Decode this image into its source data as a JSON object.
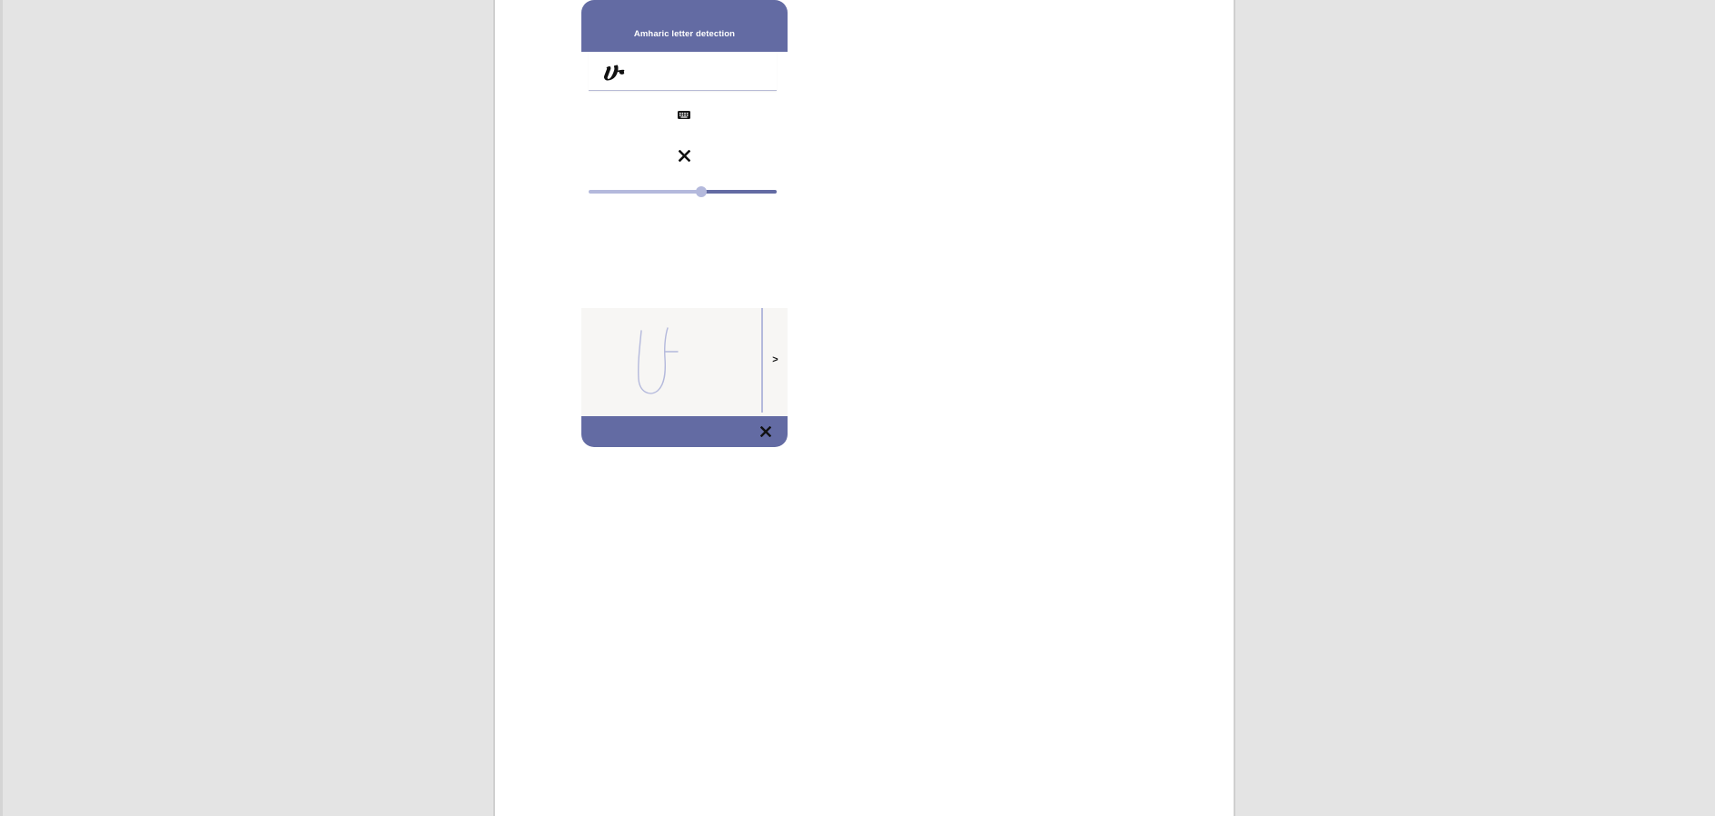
{
  "app": {
    "title": "Amharic letter detection",
    "accent_color": "#636ba3",
    "accent_light_color": "#b4b9dc"
  },
  "result": {
    "text": "ሁ"
  },
  "keyboard_button": {
    "icon": "keyboard-icon"
  },
  "clear_button": {
    "icon": "close-icon"
  },
  "slider": {
    "value_fraction": 0.6
  },
  "canvas": {
    "next_label": ">",
    "background_color": "#f7f6f4",
    "stroke_color": "#b4b9dc"
  },
  "bottom_bar": {
    "close_icon": "close-icon"
  }
}
